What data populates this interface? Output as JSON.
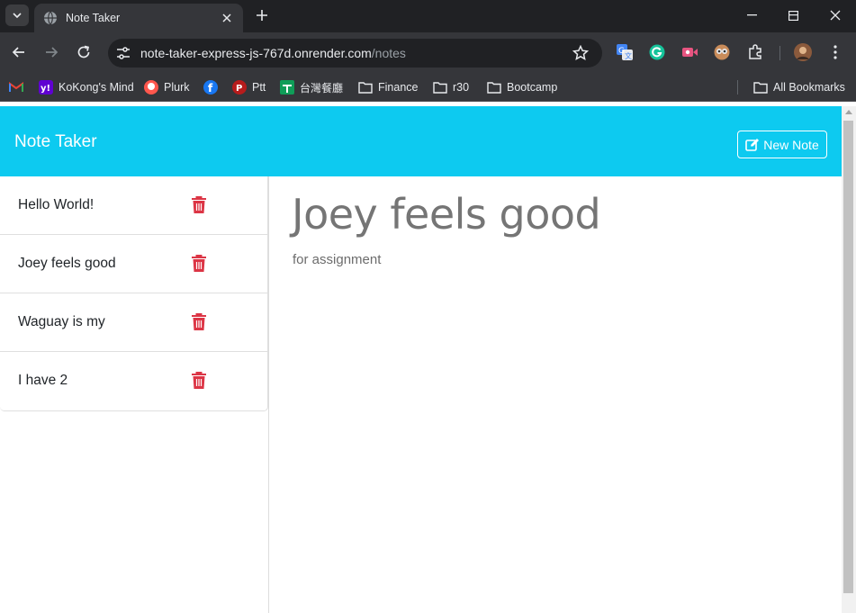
{
  "browser": {
    "tab_title": "Note Taker",
    "url_host": "note-taker-express-js-767d.onrender.com",
    "url_path": "/notes",
    "bookmarks": [
      {
        "label": "",
        "icon": "gmail-icon"
      },
      {
        "label": "KoKong's Mind",
        "icon": "yahoo-icon"
      },
      {
        "label": "Plurk",
        "icon": "plurk-icon"
      },
      {
        "label": "",
        "icon": "facebook-icon"
      },
      {
        "label": "Ptt",
        "icon": "ptt-icon"
      },
      {
        "label": "台灣餐廳",
        "icon": "sheets-icon"
      },
      {
        "label": "Finance",
        "icon": "folder-icon"
      },
      {
        "label": "r30",
        "icon": "folder-icon"
      },
      {
        "label": "Bootcamp",
        "icon": "folder-icon"
      }
    ],
    "all_bookmarks": "All Bookmarks"
  },
  "app": {
    "brand": "Note Taker",
    "new_note_label": "New Note",
    "accent_color": "#0dcaf0",
    "delete_color": "#dc3545"
  },
  "notes": [
    {
      "title": "Hello World!"
    },
    {
      "title": "Joey feels good"
    },
    {
      "title": "Waguay is my"
    },
    {
      "title": "I have 2"
    }
  ],
  "active_note": {
    "title": "Joey feels good",
    "text": "for assignment"
  }
}
